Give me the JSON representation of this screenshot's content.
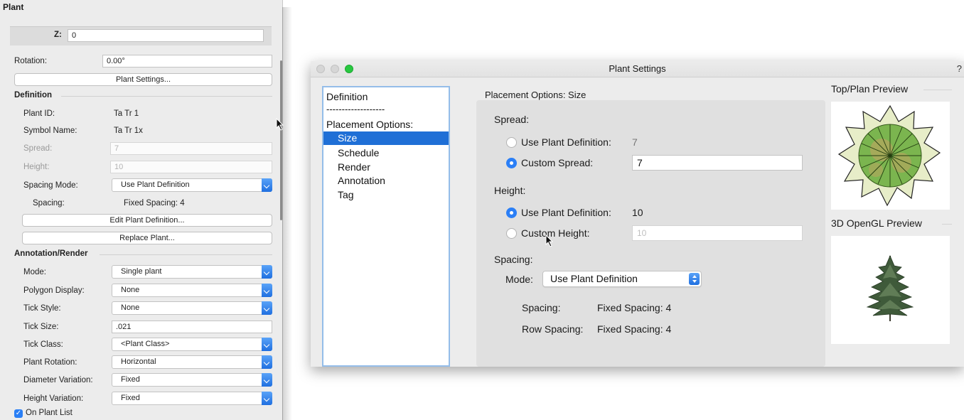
{
  "oip": {
    "title": "Plant",
    "z_label": "Z:",
    "z_value": "0",
    "rotation_label": "Rotation:",
    "rotation_value": "0.00°",
    "plant_settings_button": "Plant Settings...",
    "definition_section": "Definition",
    "plant_id_label": "Plant ID:",
    "plant_id_value": "Ta Tr 1",
    "symbol_name_label": "Symbol Name:",
    "symbol_name_value": "Ta Tr 1x",
    "spread_label": "Spread:",
    "spread_value": "7",
    "height_label": "Height:",
    "height_value": "10",
    "spacing_mode_label": "Spacing Mode:",
    "spacing_mode_value": "Use Plant Definition",
    "spacing_label": "Spacing:",
    "spacing_value": "Fixed Spacing: 4",
    "edit_plant_definition_button": "Edit Plant Definition...",
    "replace_plant_button": "Replace Plant...",
    "annotation_section": "Annotation/Render",
    "mode_label": "Mode:",
    "mode_value": "Single plant",
    "polygon_display_label": "Polygon Display:",
    "polygon_display_value": "None",
    "tick_style_label": "Tick Style:",
    "tick_style_value": "None",
    "tick_size_label": "Tick Size:",
    "tick_size_value": ".021",
    "tick_class_label": "Tick Class:",
    "tick_class_value": "<Plant Class>",
    "plant_rotation_label": "Plant Rotation:",
    "plant_rotation_value": "Horizontal",
    "diameter_variation_label": "Diameter Variation:",
    "diameter_variation_value": "Fixed",
    "height_variation_label": "Height Variation:",
    "height_variation_value": "Fixed",
    "on_plant_list_label": "On Plant List",
    "on_plant_list_checked": true
  },
  "dialog": {
    "title": "Plant Settings",
    "help": "?",
    "nav": {
      "definition": "Definition",
      "divider": "-------------------",
      "placement_options": "Placement Options:",
      "size": "Size",
      "schedule": "Schedule",
      "render": "Render",
      "annotation": "Annotation",
      "tag": "Tag"
    },
    "heading": "Placement Options: Size",
    "spread_heading": "Spread:",
    "spread_use_def_label": "Use Plant Definition:",
    "spread_use_def_value": "7",
    "custom_spread_label": "Custom Spread:",
    "custom_spread_value": "7",
    "height_heading": "Height:",
    "height_use_def_label": "Use Plant Definition:",
    "height_use_def_value": "10",
    "custom_height_label": "Custom Height:",
    "custom_height_value": "10",
    "spacing_heading": "Spacing:",
    "mode_label": "Mode:",
    "mode_value": "Use Plant Definition",
    "spacing_label": "Spacing:",
    "spacing_value": "Fixed Spacing: 4",
    "row_spacing_label": "Row Spacing:",
    "row_spacing_value": "Fixed Spacing: 4",
    "top_preview_title": "Top/Plan Preview",
    "opengl_preview_title": "3D OpenGL Preview"
  },
  "colors": {
    "accent": "#1f6fd6",
    "traffic_close": "#d9d9d9",
    "traffic_min": "#d9d9d9",
    "traffic_zoom": "#28c840"
  }
}
